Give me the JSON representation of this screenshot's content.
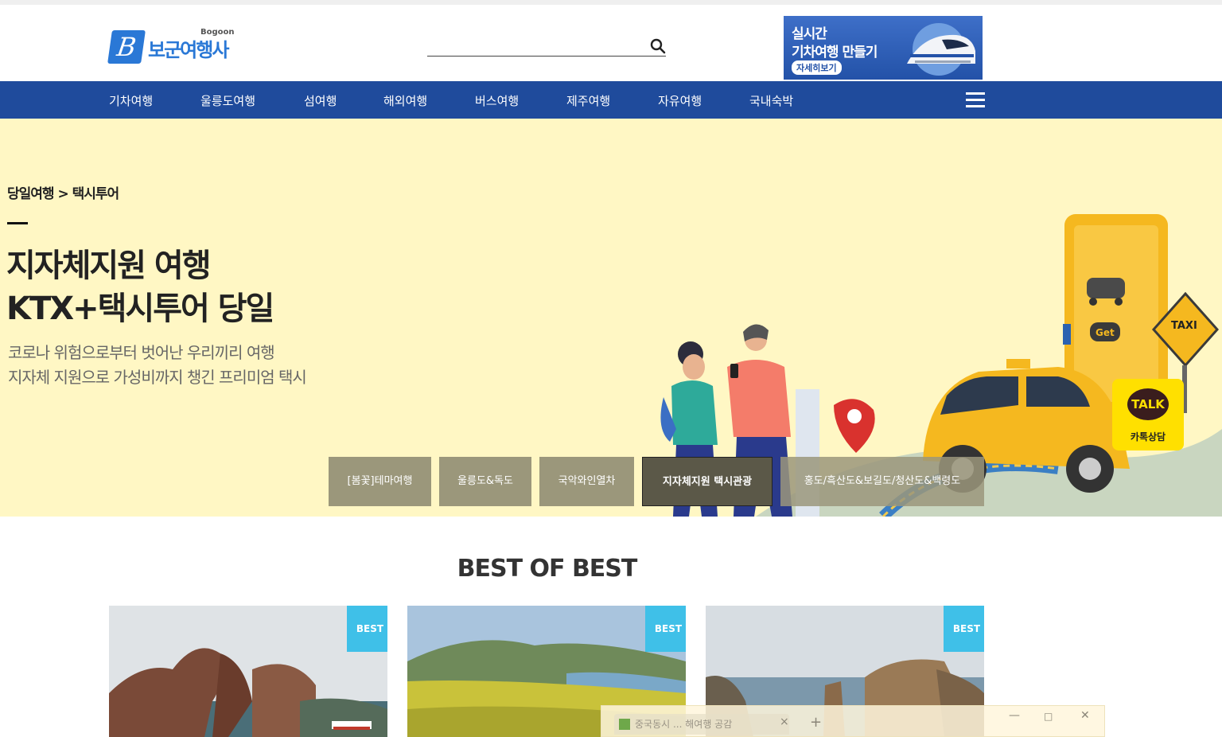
{
  "header": {
    "logo_text": "보군여행사",
    "logo_eng": "Bogoon",
    "logo_letter": "B",
    "search": {
      "placeholder": "",
      "value": "",
      "icon": "search-icon"
    },
    "banner": {
      "line1": "실시간",
      "line2": "기차여행 만들기",
      "button": "자세히보기"
    }
  },
  "nav": {
    "items": [
      "기차여행",
      "울릉도여행",
      "섬여행",
      "해외여행",
      "버스여행",
      "제주여행",
      "자유여행",
      "국내숙박"
    ],
    "menu_icon": "hamburger-menu-icon"
  },
  "hero": {
    "breadcrumb": "당일여행 > 택시투어",
    "title_line1": "지자체지원 여행",
    "title_line2": "KTX+택시투어 당일",
    "subtitle_line1": "코로나 위험으로부터 벗어난 우리끼리 여행",
    "subtitle_line2": "지자체 지원으로 가성비까지 챙긴 프리미엄 택시",
    "art_labels": {
      "get": "Get",
      "taxi_sign": "TAXI"
    },
    "talk": {
      "bubble": "TALK",
      "label": "카톡상담"
    },
    "tabs": [
      "[봄꽃]테마여행",
      "울릉도&독도",
      "국악와인열차",
      "지자체지원 택시관광",
      "홍도/흑산도&보길도/청산도&백령도"
    ],
    "active_tab": 3
  },
  "best": {
    "title": "BEST OF BEST",
    "badge": "BEST"
  },
  "popup": {
    "tab_text": "중국동시 ... 해여행 공감",
    "close": "×",
    "plus": "+",
    "minimize": "—",
    "maximize": "□",
    "exit": "✕"
  },
  "colors": {
    "nav_bg": "#1f4b9c",
    "hero_bg": "#fff7c4",
    "tab_bg": "#9b977b",
    "tab_active_bg": "#5b5848",
    "badge": "#3fc0e8",
    "brand": "#2a78d6",
    "taxi_yellow": "#f5b81f"
  }
}
